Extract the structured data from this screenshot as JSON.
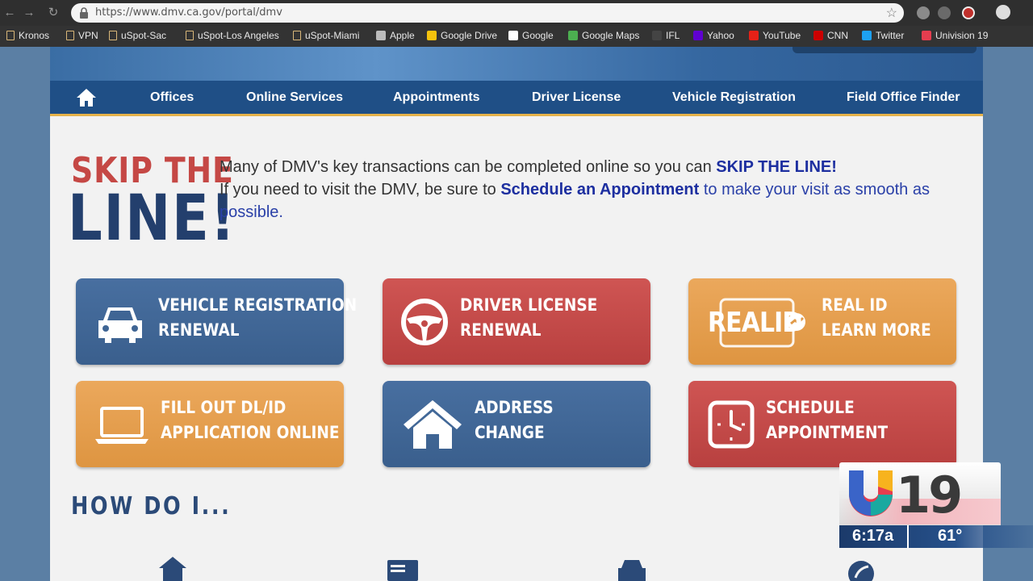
{
  "browser": {
    "url": "https://www.dmv.ca.gov/portal/dmv",
    "bookmarks": [
      {
        "label": "Kronos",
        "icon": "folder-icon"
      },
      {
        "label": "VPN",
        "icon": "folder-icon"
      },
      {
        "label": "uSpot-Sac",
        "icon": "folder-icon"
      },
      {
        "label": "uSpot-Los Angeles",
        "icon": "folder-icon"
      },
      {
        "label": "uSpot-Miami",
        "icon": "folder-icon"
      },
      {
        "label": "Apple",
        "icon": "apple-icon"
      },
      {
        "label": "Google Drive",
        "icon": "google-drive-icon"
      },
      {
        "label": "Google",
        "icon": "google-icon"
      },
      {
        "label": "Google Maps",
        "icon": "google-maps-icon"
      },
      {
        "label": "IFL",
        "icon": "ifl-icon"
      },
      {
        "label": "Yahoo",
        "icon": "yahoo-icon"
      },
      {
        "label": "YouTube",
        "icon": "youtube-icon"
      },
      {
        "label": "CNN",
        "icon": "cnn-icon"
      },
      {
        "label": "Twitter",
        "icon": "twitter-icon"
      },
      {
        "label": "Univision 19",
        "icon": "univision-icon"
      }
    ]
  },
  "nav": {
    "items": [
      "Offices",
      "Online Services",
      "Appointments",
      "Driver License",
      "Vehicle Registration",
      "Field Office Finder"
    ]
  },
  "skip": {
    "logo_top": "SKIP THE",
    "logo_bottom": "LINE!",
    "line1_pre": "Many of DMV's key transactions can be completed online so you can ",
    "line1_bold": "SKIP THE LINE!",
    "line2_pre": "If you need to visit the DMV, be sure to ",
    "line2_bold": "Schedule an Appointment",
    "line2_post": " to make your visit as smooth as possible."
  },
  "tiles": [
    {
      "line1": "VEHICLE REGISTRATION",
      "line2": "RENEWAL",
      "icon": "car-icon"
    },
    {
      "line1": "DRIVER LICENSE",
      "line2": "RENEWAL",
      "icon": "steering-wheel-icon"
    },
    {
      "line1": "REAL ID",
      "line2": "LEARN MORE",
      "icon": "real-id-icon",
      "badge": "REALID"
    },
    {
      "line1": "FILL OUT DL/ID",
      "line2": "APPLICATION ONLINE",
      "icon": "laptop-icon"
    },
    {
      "line1": "ADDRESS",
      "line2": "CHANGE",
      "icon": "house-icon"
    },
    {
      "line1": "SCHEDULE",
      "line2": "APPOINTMENT",
      "icon": "clock-icon"
    }
  ],
  "how_do_i": "HOW DO I...",
  "tv": {
    "channel": "19",
    "time": "6:17a",
    "temp": "61°"
  },
  "colors": {
    "nav_bg": "#1f4f86",
    "tile_blue": "#3a5f8d",
    "tile_red": "#b8403f",
    "tile_orange": "#de9541",
    "skip_red": "#c54845",
    "skip_navy": "#233f6d"
  }
}
